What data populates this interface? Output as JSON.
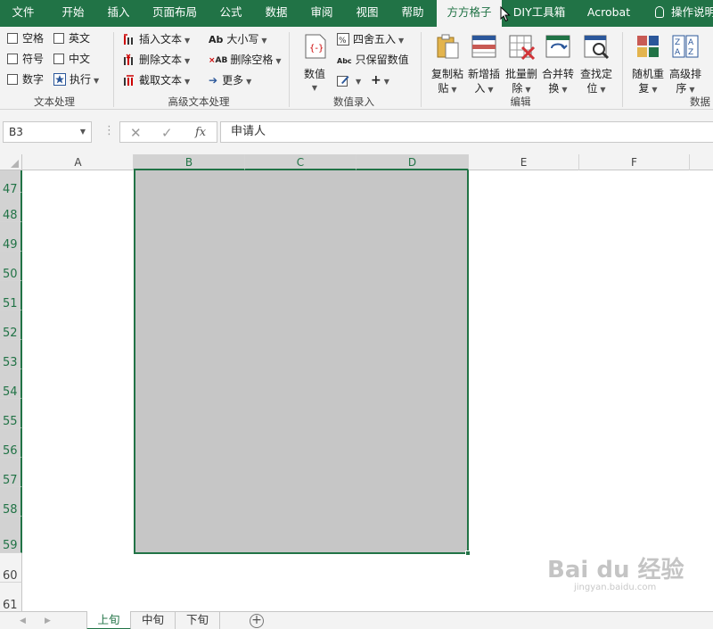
{
  "ribbon_tabs": [
    "文件",
    "开始",
    "插入",
    "页面布局",
    "公式",
    "数据",
    "审阅",
    "视图",
    "帮助",
    "方方格子",
    "DIY工具箱",
    "Acrobat"
  ],
  "active_tab": "方方格子",
  "tell_me": "操作说明",
  "groups": {
    "text_processing": {
      "label": "文本处理",
      "checkboxes": [
        "空格",
        "英文",
        "符号",
        "中文",
        "数字"
      ],
      "execute": "执行"
    },
    "advanced_text": {
      "label": "高级文本处理",
      "buttons": [
        "插入文本",
        "删除文本",
        "截取文本",
        "大小写",
        "删除空格",
        "更多"
      ],
      "icon_texts": [
        "Ab",
        "AB",
        "Abc"
      ]
    },
    "number_input": {
      "label": "数值录入",
      "buttons": [
        "数值",
        "四舍五入",
        "只保留数值"
      ]
    },
    "edit": {
      "label": "编辑",
      "buttons": [
        [
          "复制粘",
          "贴"
        ],
        [
          "新增插",
          "入"
        ],
        [
          "批量删",
          "除"
        ],
        [
          "合并转",
          "换"
        ],
        [
          "查找定",
          "位"
        ]
      ]
    },
    "data": {
      "label": "数据",
      "buttons": [
        [
          "随机重",
          "复"
        ],
        [
          "高级排",
          "序"
        ]
      ]
    }
  },
  "formula_bar": {
    "name_box": "B3",
    "formula": "申请人",
    "fx": "fx"
  },
  "columns": [
    "A",
    "B",
    "C",
    "D",
    "E",
    "F"
  ],
  "selected_columns": [
    "B",
    "C",
    "D"
  ],
  "rows": [
    "47",
    "48",
    "49",
    "50",
    "51",
    "52",
    "53",
    "54",
    "55",
    "56",
    "57",
    "58",
    "59",
    "60",
    "61"
  ],
  "selected_rows": [
    "47",
    "48",
    "49",
    "50",
    "51",
    "52",
    "53",
    "54",
    "55",
    "56",
    "57",
    "58",
    "59"
  ],
  "sheets": [
    "上旬",
    "中旬",
    "下旬"
  ],
  "active_sheet": "上旬",
  "watermark": {
    "main": "Bai du 经验",
    "sub": "jingyan.baidu.com"
  },
  "colors": {
    "excel_green": "#217346",
    "selection_fill": "#c6c6c6"
  }
}
